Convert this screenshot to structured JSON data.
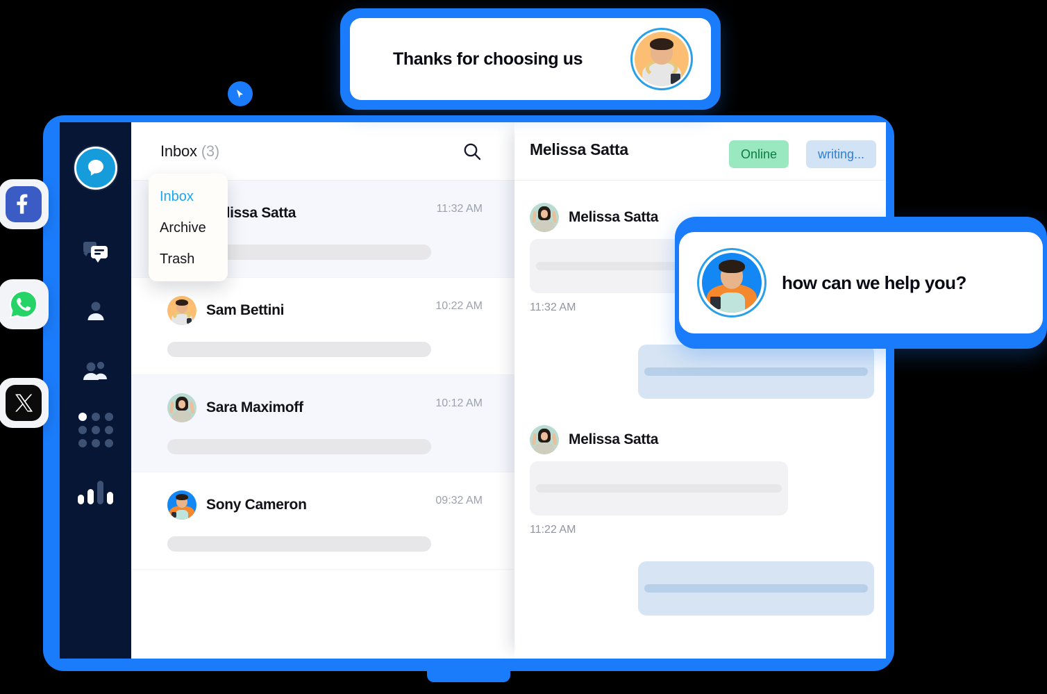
{
  "top_card": {
    "message": "Thanks for choosing us",
    "avatar_name": "surprised-man-avatar"
  },
  "social_badges": [
    {
      "name": "facebook",
      "glyph": "f",
      "color": "#3B5CC4"
    },
    {
      "name": "whatsapp",
      "glyph": "",
      "color": "#25D366"
    },
    {
      "name": "x-twitter",
      "glyph": "X",
      "color": "#0B0B0B"
    }
  ],
  "sidebar": {
    "logo_name": "chat-bubble-logo",
    "items": [
      {
        "name": "messages",
        "icon": "chat-bubbles-icon"
      },
      {
        "name": "contacts",
        "icon": "user-icon"
      },
      {
        "name": "teams",
        "icon": "users-group-icon"
      },
      {
        "name": "apps",
        "icon": "grid-dots-icon"
      },
      {
        "name": "analytics",
        "icon": "bar-chart-icon"
      }
    ]
  },
  "inbox": {
    "title": "Inbox",
    "count": "(3)",
    "search_icon": "search-icon",
    "dropdown": {
      "items": [
        {
          "label": "Inbox",
          "active": true
        },
        {
          "label": "Archive",
          "active": false
        },
        {
          "label": "Trash",
          "active": false
        }
      ]
    },
    "rows": [
      {
        "name": "Melissa Satta",
        "time": "11:32 AM",
        "avatar": "mint",
        "selected": true
      },
      {
        "name": "Sam Bettini",
        "time": "10:22 AM",
        "avatar": "orange",
        "selected": false
      },
      {
        "name": "Sara Maximoff",
        "time": "10:12 AM",
        "avatar": "mint",
        "selected": true
      },
      {
        "name": "Sony Cameron",
        "time": "09:32 AM",
        "avatar": "blue",
        "selected": false
      }
    ]
  },
  "chat": {
    "contact_name": "Melissa Satta",
    "status_badge": "Online",
    "typing_badge": "writing...",
    "messages": [
      {
        "sender": "Melissa Satta",
        "time": "11:32 AM",
        "direction": "in",
        "avatar": "mint"
      },
      {
        "sender": "",
        "time": "",
        "direction": "out",
        "avatar": ""
      },
      {
        "sender": "Melissa Satta",
        "time": "11:22 AM",
        "direction": "in",
        "avatar": "mint"
      },
      {
        "sender": "",
        "time": "",
        "direction": "out",
        "avatar": ""
      }
    ]
  },
  "help_card": {
    "message": "how can we help you?",
    "avatar_name": "smiling-man-avatar"
  },
  "colors": {
    "brand_blue": "#1B7CFB",
    "sidebar_navy": "#071635",
    "logo_blue": "#169BDB",
    "online_green_bg": "#9AE8BF",
    "online_green_text": "#0B7B41",
    "writing_blue_bg": "#D3E3F6",
    "writing_blue_text": "#2E7FD6",
    "selected_row": "#F5F7FC"
  }
}
